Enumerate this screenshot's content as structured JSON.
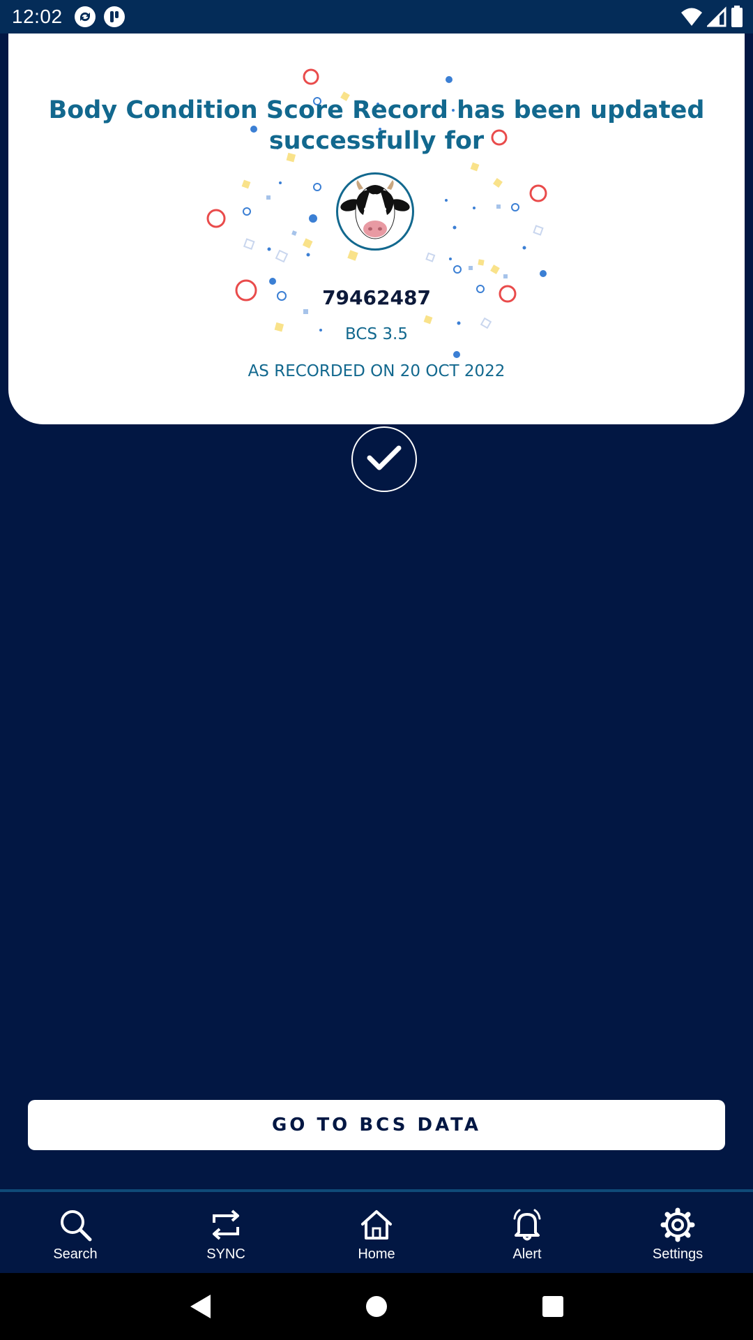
{
  "status_bar": {
    "time": "12:02",
    "icons": [
      "sync-app-icon",
      "app-notification-icon",
      "wifi-icon",
      "cellular-signal-icon",
      "battery-icon"
    ]
  },
  "success_card": {
    "title": "Body Condition Score Record has been updated successfully for",
    "animal_id": "79462487",
    "bcs": "BCS 3.5",
    "recorded": "AS RECORDED ON 20 OCT 2022",
    "avatar_icon": "cow-face-icon",
    "status_icon": "checkmark-icon"
  },
  "primary_button": {
    "label": "GO TO BCS DATA"
  },
  "bottom_nav": {
    "items": [
      {
        "label": "Search",
        "icon": "search-icon"
      },
      {
        "label": "SYNC",
        "icon": "sync-icon"
      },
      {
        "label": "Home",
        "icon": "home-icon"
      },
      {
        "label": "Alert",
        "icon": "bell-icon"
      },
      {
        "label": "Settings",
        "icon": "gear-icon"
      }
    ]
  },
  "system_nav": {
    "icons": [
      "back-icon",
      "home-circle-icon",
      "recents-icon"
    ]
  },
  "colors": {
    "background": "#021743",
    "status_bar": "#042c58",
    "accent": "#12688e",
    "card": "#ffffff",
    "confetti_red": "#e94b4b",
    "confetti_blue": "#3b7fd4",
    "confetti_yellow": "#f9e28a"
  }
}
